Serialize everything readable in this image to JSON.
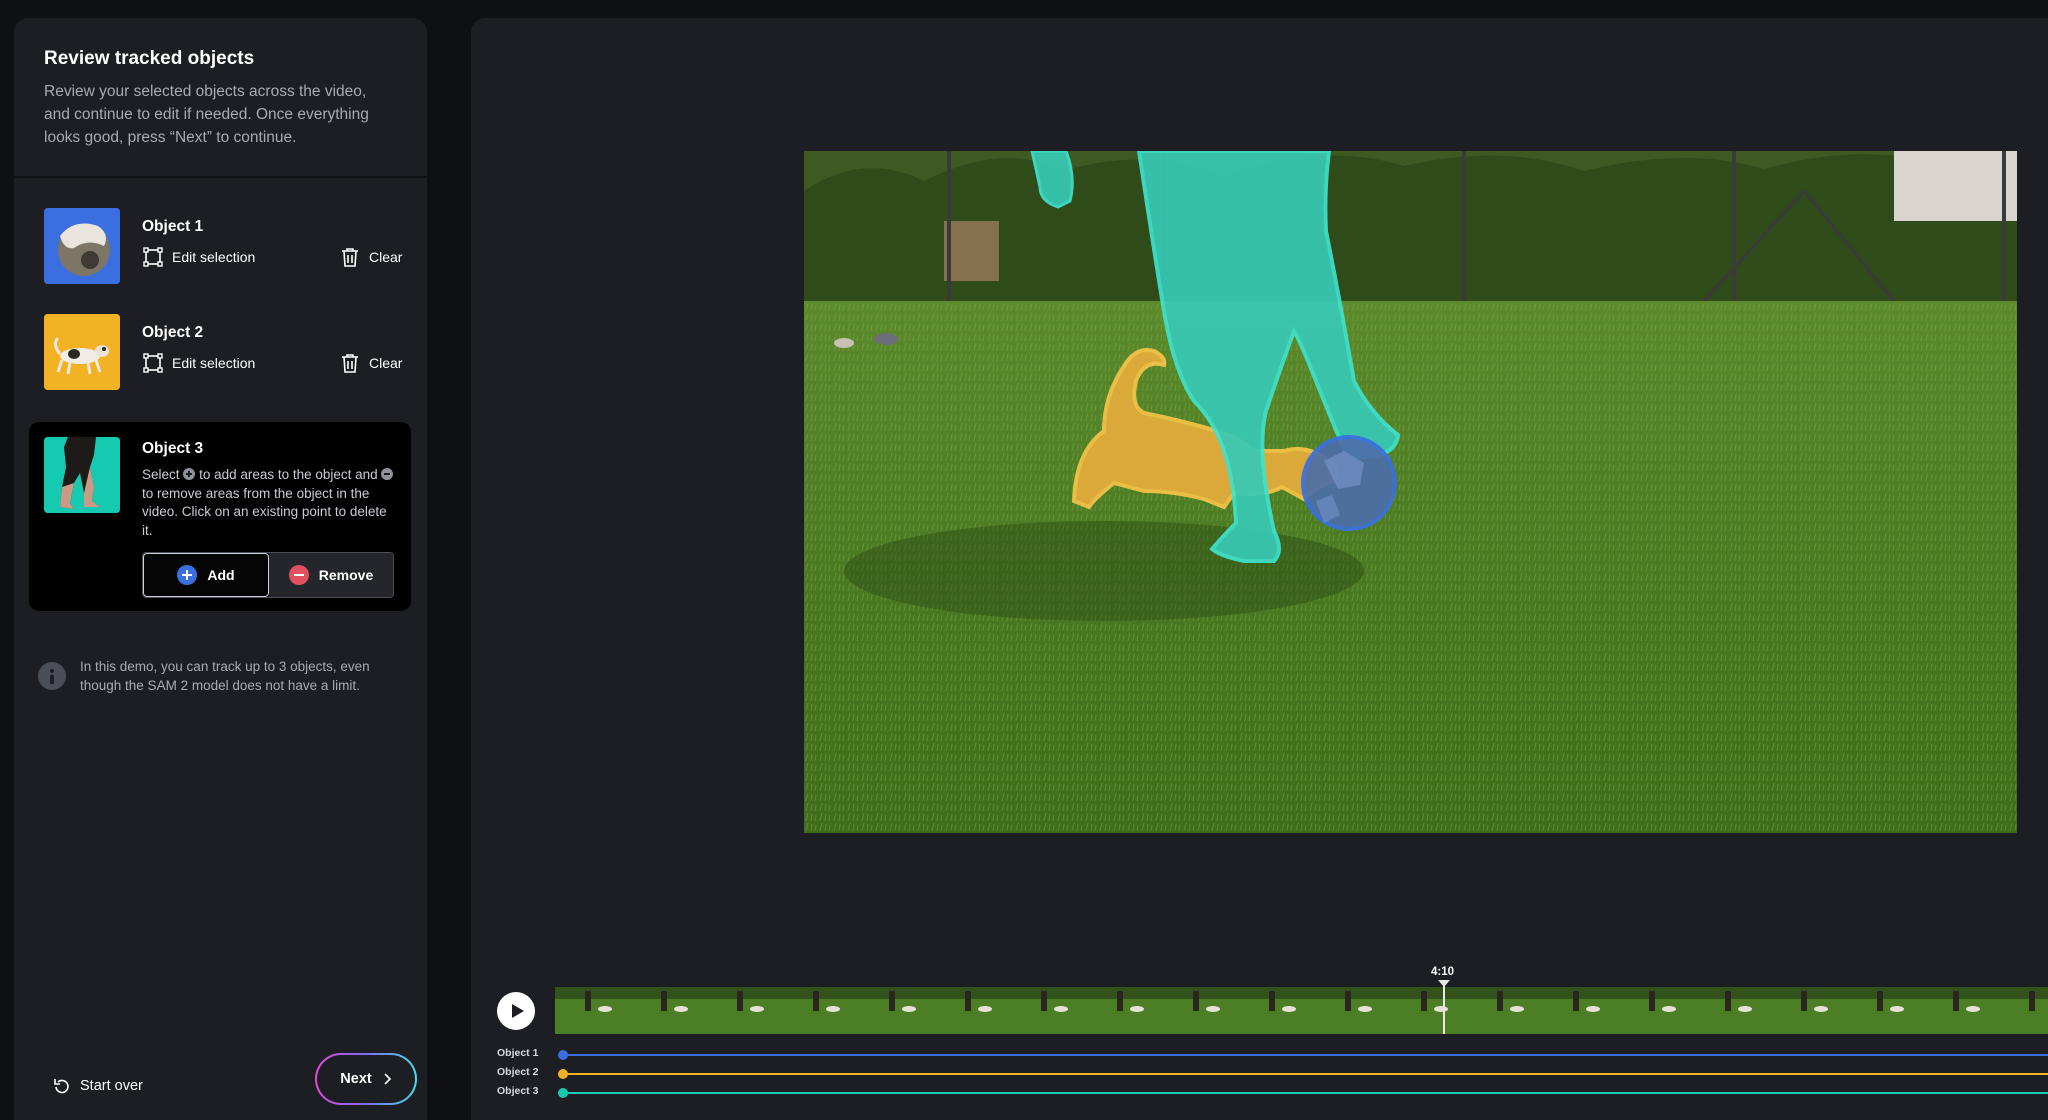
{
  "sidebar": {
    "title": "Review tracked objects",
    "description": "Review your selected objects across the video, and continue to edit if needed. Once everything looks good, press “Next” to continue.",
    "objects": [
      {
        "name": "Object 1",
        "edit_label": "Edit selection",
        "clear_label": "Clear",
        "thumb_color": "#3b6fe0"
      },
      {
        "name": "Object 2",
        "edit_label": "Edit selection",
        "clear_label": "Clear",
        "thumb_color": "#f3b124"
      },
      {
        "name": "Object 3",
        "thumb_color": "#16c9b1",
        "help_1": "Select",
        "help_2": "to add areas to the object and",
        "help_3": "to remove areas from the object in the video. Click on an existing point to delete it.",
        "add_label": "Add",
        "remove_label": "Remove"
      }
    ],
    "info_note": "In this demo, you can track up to 3 objects, even though the SAM 2 model does not have a limit.",
    "start_over_label": "Start over",
    "next_label": "Next"
  },
  "timeline": {
    "current_time": "4:10",
    "tracks": [
      {
        "label": "Object 1",
        "color": "#3b6fe0"
      },
      {
        "label": "Object 2",
        "color": "#f3b124"
      },
      {
        "label": "Object 3",
        "color": "#16c9b1"
      }
    ]
  },
  "colors": {
    "add": "#3b6fe0",
    "remove": "#e0505e",
    "accent_gradient": [
      "#e14ad5",
      "#7b6cf6",
      "#4cd9e8"
    ]
  }
}
